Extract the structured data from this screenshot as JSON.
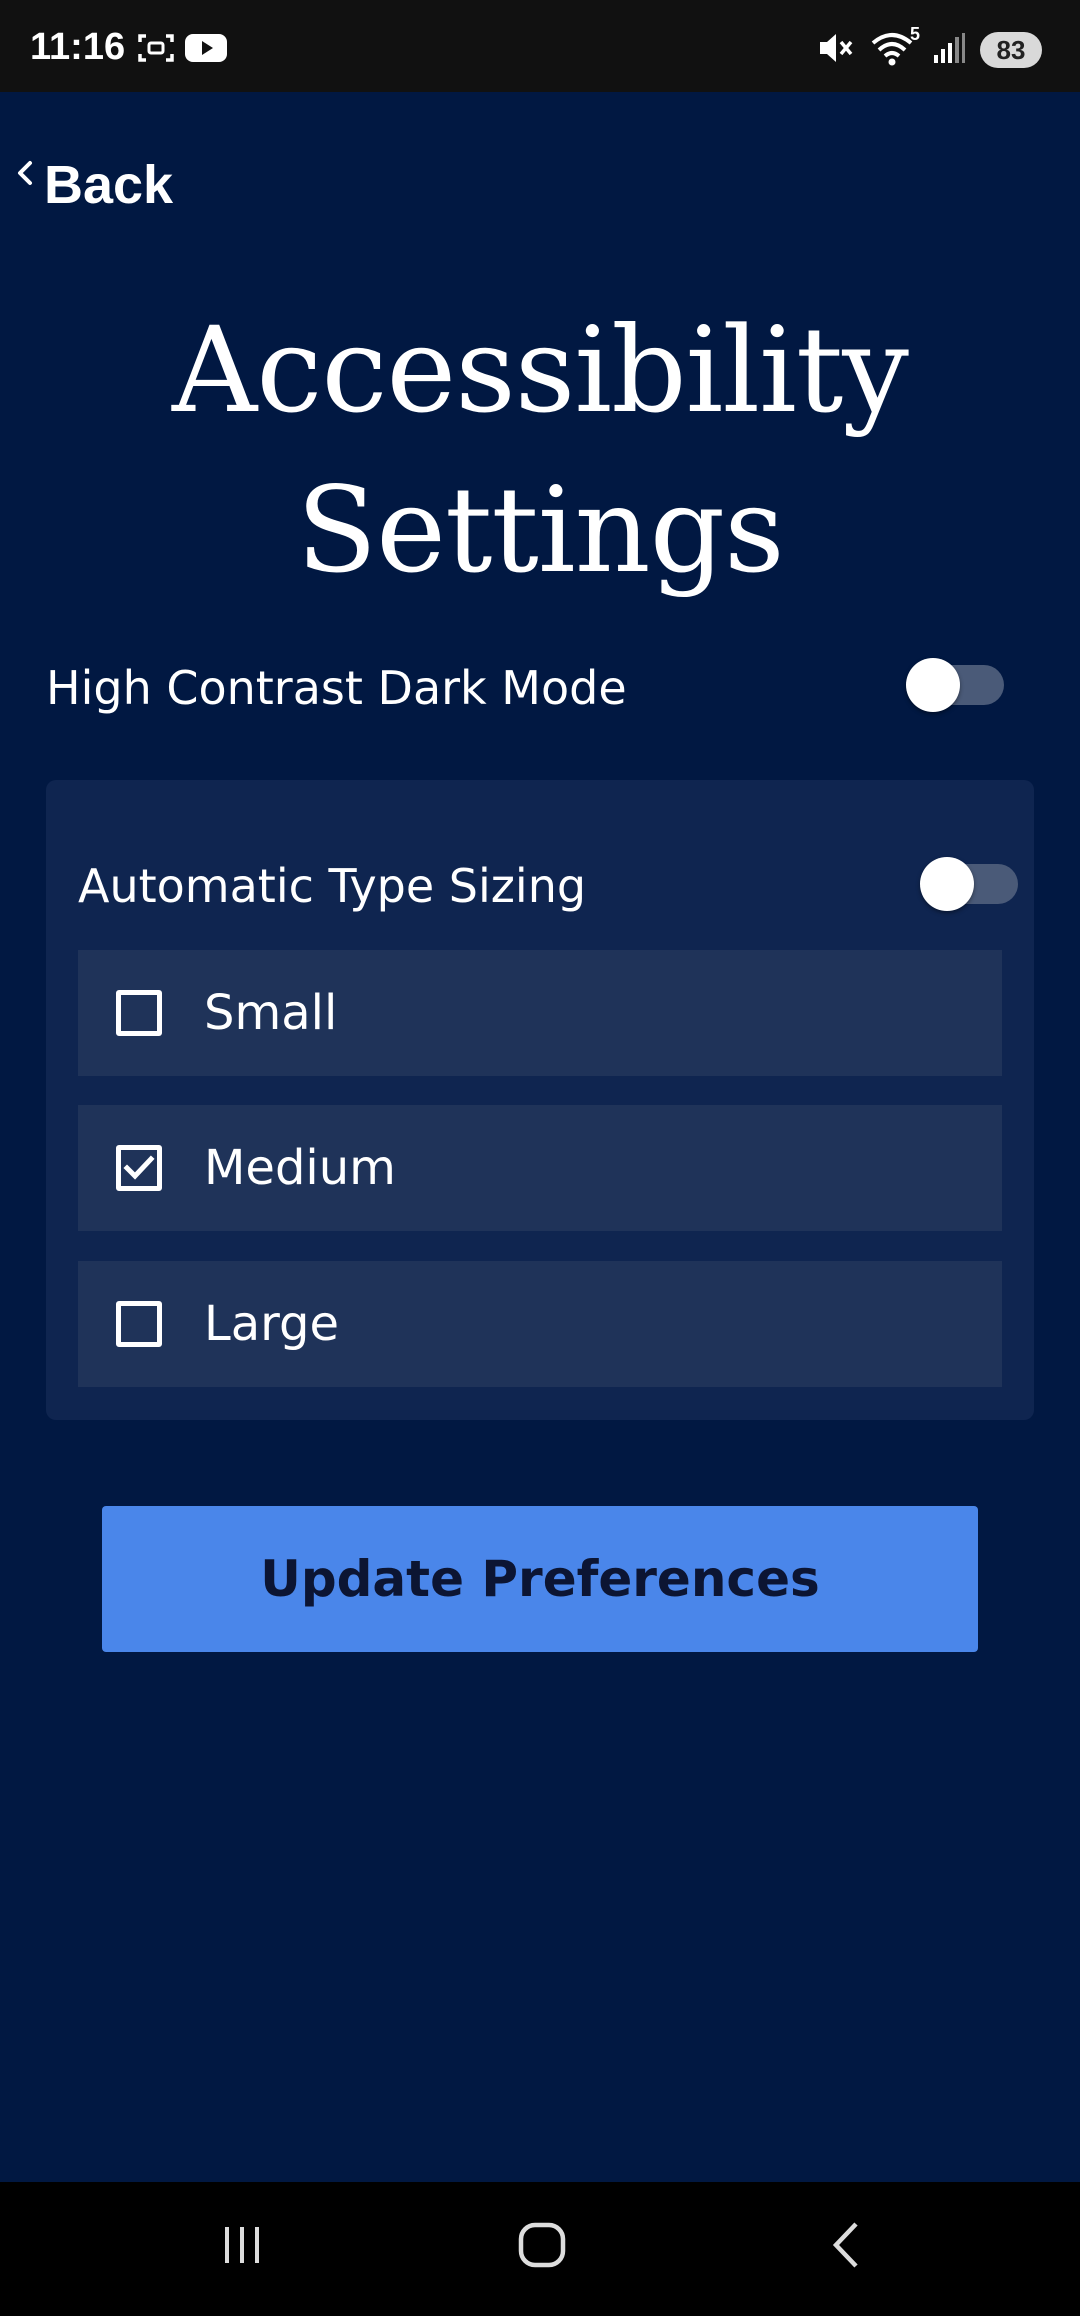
{
  "status_bar": {
    "time": "11:16",
    "battery": "83",
    "left_icons": [
      "screenshot-icon",
      "youtube-icon"
    ],
    "right_icons": [
      "mute-icon",
      "wifi-icon",
      "signal-icon"
    ],
    "wifi_badge": "5"
  },
  "nav": {
    "back_label": "Back"
  },
  "page": {
    "title_line1": "Accessibility",
    "title_line2": "Settings"
  },
  "settings": {
    "high_contrast": {
      "label": "High Contrast Dark Mode",
      "enabled": false
    },
    "type_sizing": {
      "label": "Automatic Type Sizing",
      "enabled": false,
      "options": [
        {
          "label": "Small",
          "checked": false
        },
        {
          "label": "Medium",
          "checked": true
        },
        {
          "label": "Large",
          "checked": false
        }
      ]
    }
  },
  "actions": {
    "update_label": "Update Preferences"
  },
  "colors": {
    "background": "#011842",
    "panel": "#0f2550",
    "option": "#1f3359",
    "primary_button": "#4a86ea",
    "toggle_track": "#4a5a78"
  },
  "system_nav": [
    "recents-icon",
    "home-icon",
    "back-icon"
  ]
}
